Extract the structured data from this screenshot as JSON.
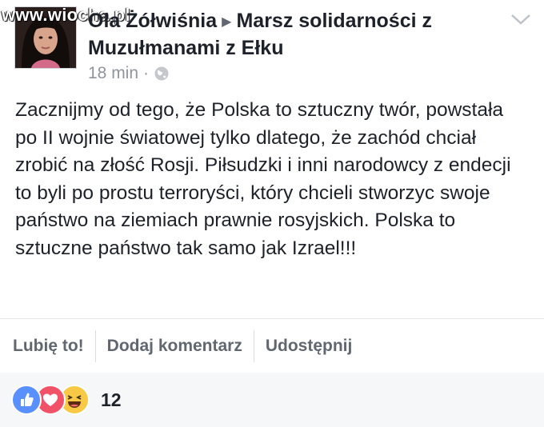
{
  "header": {
    "watermark": "www.wiocha.pl",
    "author": "Ola Żółwiśnia",
    "arrow": "▶",
    "group": "Marsz solidarności z Muzułmanami z Ełku",
    "time": "18 min",
    "separator": "·",
    "privacy_icon": "globe-icon",
    "menu_icon": "chevron-down-icon"
  },
  "post": {
    "text": "Zacznijmy od tego, że Polska to sztuczny twór, powstała po II wojnie światowej tylko dlatego, że zachód chciał zrobić na złość Rosji. Piłsudzki i inni narodowcy z endecji to byli po prostu terroryści, który chcieli stworzyc swoje państwo na ziemiach prawnie rosyjskich. Polska to sztuczne państwo tak samo jak Izrael!!!"
  },
  "actions": {
    "like": "Lubię to!",
    "comment": "Dodaj komentarz",
    "share": "Udostępnij"
  },
  "reactions": {
    "icons": [
      "like-icon",
      "love-icon",
      "haha-icon"
    ],
    "count": "12"
  },
  "colors": {
    "text": "#1d2129",
    "muted": "#90949c",
    "action": "#606770",
    "like": "#5890ff",
    "love": "#f25268",
    "haha": "#f7c945"
  }
}
